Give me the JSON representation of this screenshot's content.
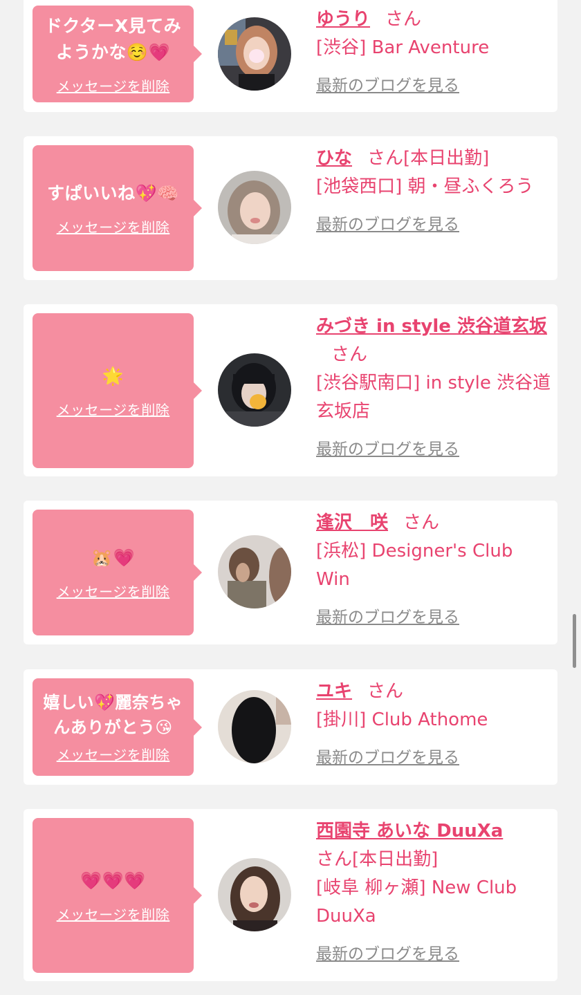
{
  "cards": [
    {
      "message": "ドクターX見てみようかな☺️💗",
      "delete_label": "メッセージを削除",
      "name": "ゆうり",
      "san": "さん",
      "status": "",
      "shop": "[渋谷] Bar Aventure",
      "blog_label": "最新のブログを見る"
    },
    {
      "message": "すぱいいね💖🧠",
      "delete_label": "メッセージを削除",
      "name": "ひな",
      "san": "さん",
      "status": "[本日出勤]",
      "shop": "[池袋西口] 朝・昼ふくろう",
      "blog_label": "最新のブログを見る"
    },
    {
      "message": "🌟",
      "delete_label": "メッセージを削除",
      "name": "みづき in style 渋谷道玄坂",
      "san": "さん",
      "status": "",
      "shop": "[渋谷駅南口] in style 渋谷道玄坂店",
      "blog_label": "最新のブログを見る"
    },
    {
      "message": "🐹💗",
      "delete_label": "メッセージを削除",
      "name": "逢沢　咲",
      "san": "さん",
      "status": "",
      "shop": "[浜松] Designer's Club Win",
      "blog_label": "最新のブログを見る"
    },
    {
      "message": "嬉しい💖麗奈ちゃんありがとう😘",
      "delete_label": "メッセージを削除",
      "name": "ユキ",
      "san": "さん",
      "status": "",
      "shop": "[掛川] Club Athome",
      "blog_label": "最新のブログを見る"
    },
    {
      "message": "💗💗💗",
      "delete_label": "メッセージを削除",
      "name": "西園寺 あいな DuuXa",
      "san": "さん",
      "status": "[本日出勤]",
      "shop": "[岐阜 柳ヶ瀬] New Club DuuXa",
      "blog_label": "最新のブログを見る"
    }
  ],
  "colors": {
    "accent_pink": "#e8436f",
    "bubble_pink": "#f58ea0",
    "background": "#f2f2f2",
    "link_gray": "#8a8a8a"
  }
}
